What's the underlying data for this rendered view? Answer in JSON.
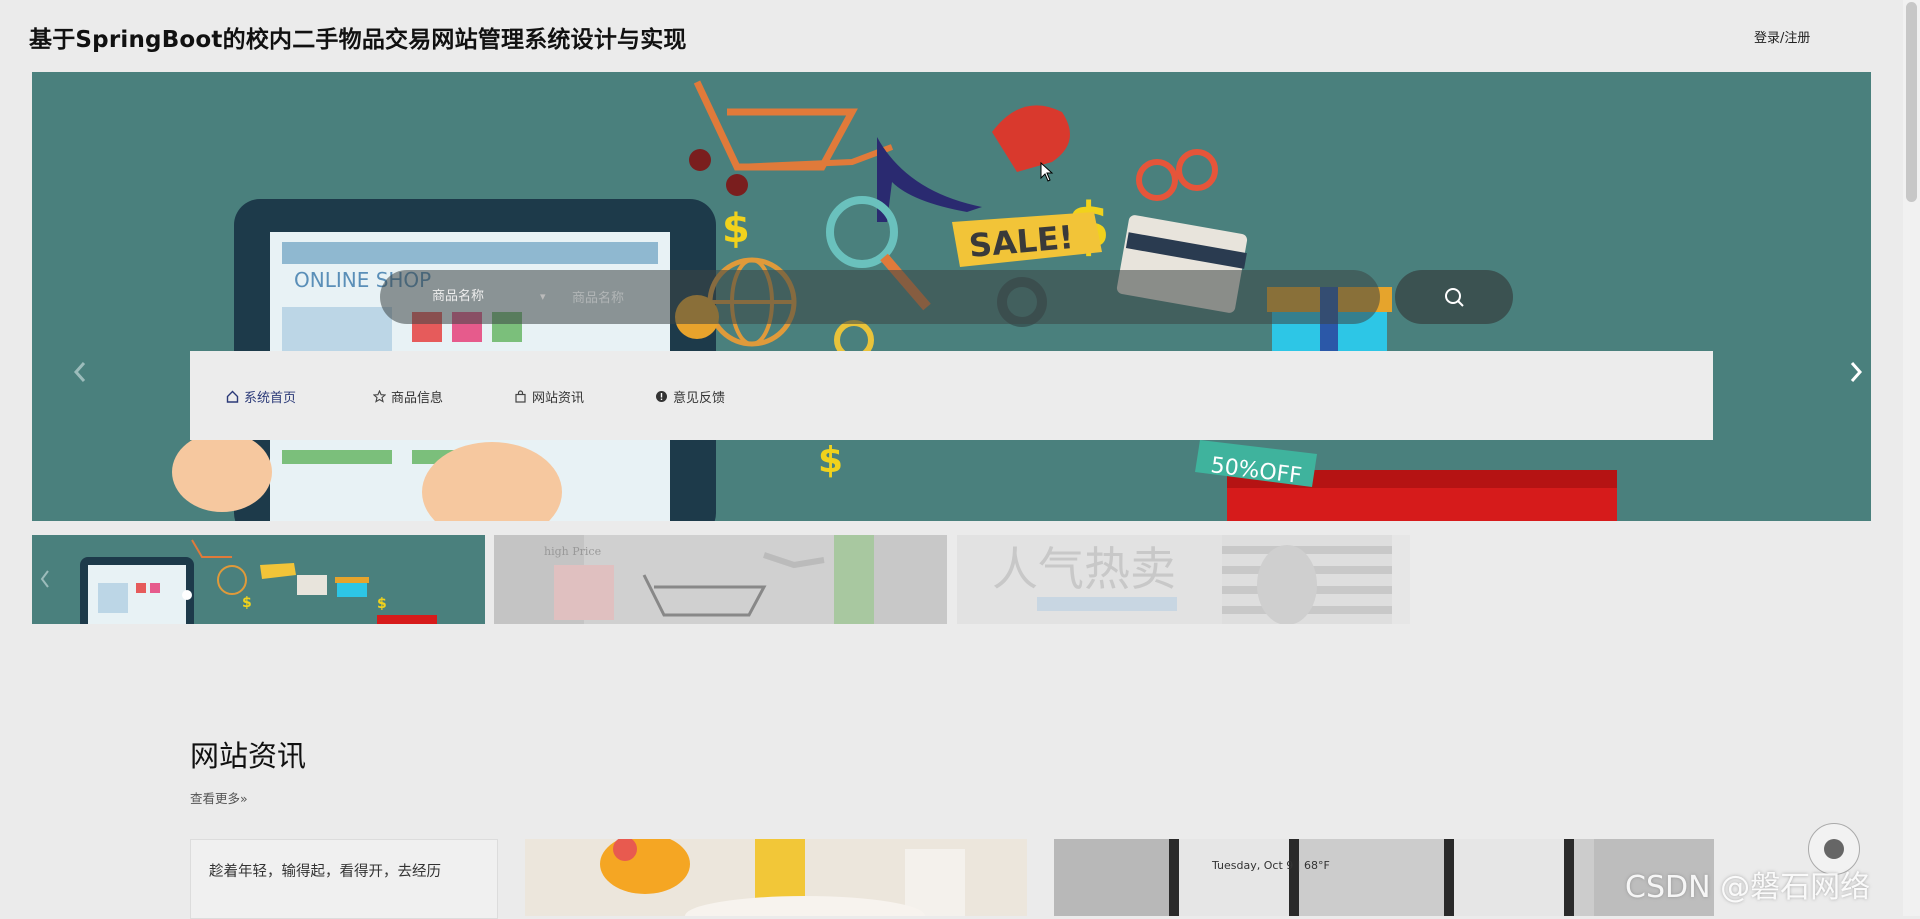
{
  "header": {
    "title": "基于SpringBoot的校内二手物品交易网站管理系统设计与实现",
    "login_label": "登录/注册"
  },
  "banner": {
    "texts": {
      "online_shop": "ONLINE SHOP",
      "sale": "SALE!",
      "off": "50%OFF",
      "dollar": "$"
    }
  },
  "search": {
    "field_selected": "商品名称",
    "placeholder": "商品名称"
  },
  "nav": {
    "items": [
      {
        "label": "系统首页",
        "icon": "home-icon"
      },
      {
        "label": "商品信息",
        "icon": "star-icon"
      },
      {
        "label": "网站资讯",
        "icon": "bag-icon"
      },
      {
        "label": "意见反馈",
        "icon": "info-icon"
      }
    ]
  },
  "thumbnails": {
    "texts": {
      "popular": "人气热卖",
      "high_price": "high Price"
    }
  },
  "news": {
    "title": "网站资讯",
    "more_label": "查看更多",
    "first_card_text": "趁着年轻，输得起，看得开，去经历",
    "phone_text": "Tuesday, Oct 9 | 68°F"
  },
  "watermark": "CSDN @磐石网络",
  "colors": {
    "banner_bg": "#4a807d",
    "nav_active": "#2b3a78",
    "page_bg": "#ebebeb"
  }
}
